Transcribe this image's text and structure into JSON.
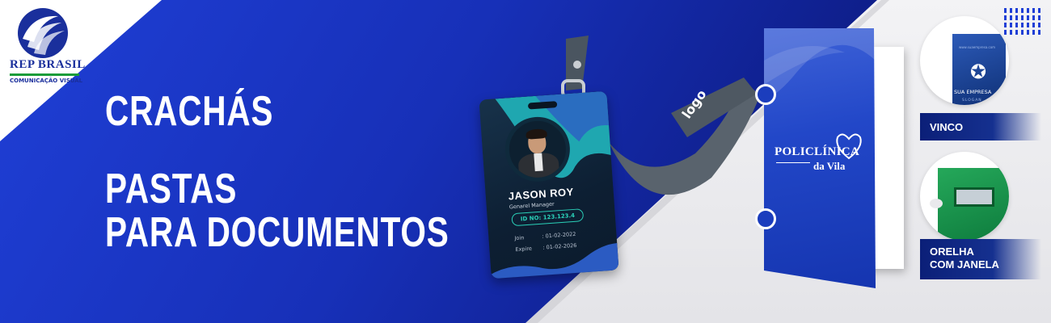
{
  "brand": {
    "name": "REP BRASIL",
    "tagline": "COMUNICAÇÃO VISUAL"
  },
  "headline": {
    "line1": "CRACHÁS",
    "line2": "PASTAS",
    "line3": "PARA DOCUMENTOS"
  },
  "badge": {
    "name": "JASON ROY",
    "role": "Genarel Manager",
    "id": "ID NO: 123.123.4",
    "join_label": "Join",
    "join_value": ": 01-02-2022",
    "expire_label": "Expire",
    "expire_value": ": 01-02-2026",
    "lanyard_text": "logo"
  },
  "folder": {
    "brand_line1": "POLICLÍNICA",
    "brand_line2": "da Vila"
  },
  "samples": {
    "vinco": {
      "label": "VINCO",
      "company": "SUA EMPRESA",
      "slogan": "SLOGAN",
      "url": "www.suaempresa.com"
    },
    "orelha": {
      "label_line1": "ORELHA",
      "label_line2": "COM JANELA"
    }
  },
  "colors": {
    "primary_blue": "#1f3fd6",
    "dark_blue": "#0a1670",
    "accent_green": "#1a9c3a",
    "badge_teal": "#2ad0b8"
  }
}
